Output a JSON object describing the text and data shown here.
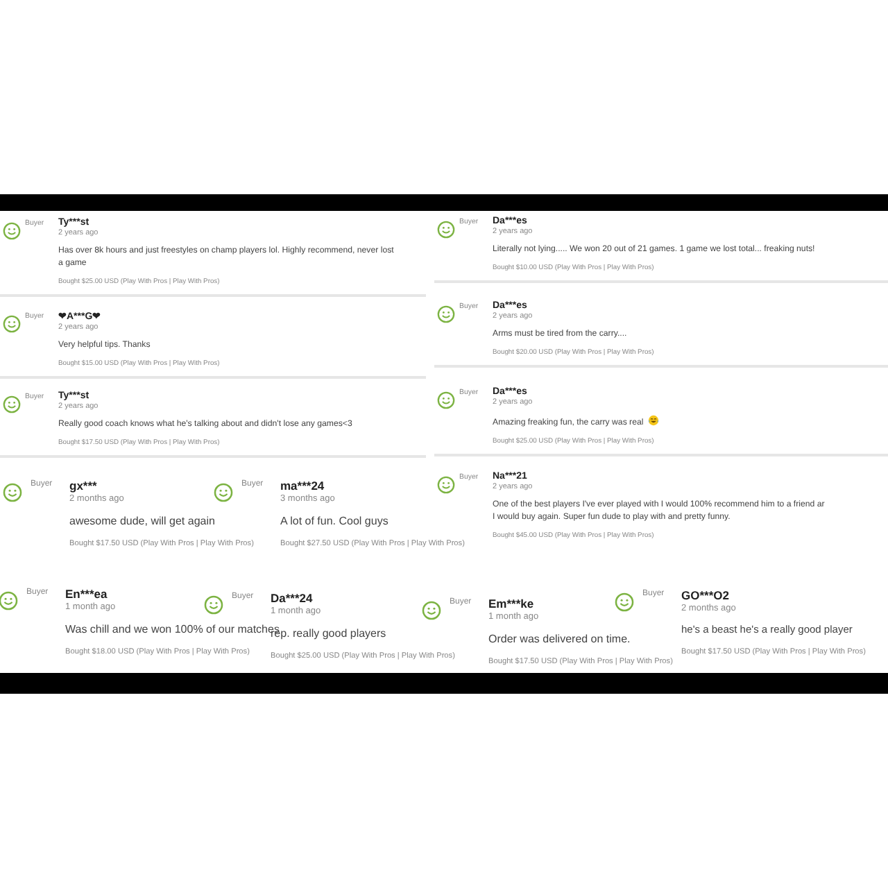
{
  "reviews": [
    {
      "name": "Ty***st",
      "badge": "Buyer",
      "date": "2 years ago",
      "text_lines": [
        "Has over 8k hours and just freestyles on champ players lol. Highly recommend, never lost",
        "a game"
      ],
      "bought": "Bought $25.00 USD  (Play With Pros | Play With Pros)"
    },
    {
      "name": "❤A***G❤",
      "badge": "Buyer",
      "date": "2 years ago",
      "text_lines": [
        "Very helpful tips. Thanks"
      ],
      "bought": "Bought $15.00 USD  (Play With Pros | Play With Pros)"
    },
    {
      "name": "Ty***st",
      "badge": "Buyer",
      "date": "2 years ago",
      "text_lines": [
        "Really good coach knows what he's talking about and didn't lose any games<3"
      ],
      "bought": "Bought $17.50 USD  (Play With Pros | Play With Pros)"
    },
    {
      "name": "Da***es",
      "badge": "Buyer",
      "date": "2 years ago",
      "text_lines": [
        "Literally not lying..... We won 20 out of 21 games. 1 game we lost total... freaking nuts!"
      ],
      "bought": "Bought $10.00 USD  (Play With Pros | Play With Pros)"
    },
    {
      "name": "Da***es",
      "badge": "Buyer",
      "date": "2 years ago",
      "text_lines": [
        "Arms must be tired from the carry...."
      ],
      "bought": "Bought $20.00 USD  (Play With Pros | Play With Pros)"
    },
    {
      "name": "Da***es",
      "badge": "Buyer",
      "date": "2 years ago",
      "text_lines": [
        "Amazing freaking fun, the carry was real"
      ],
      "emoji": true,
      "bought": "Bought $25.00 USD  (Play With Pros | Play With Pros)"
    },
    {
      "name": "Na***21",
      "badge": "Buyer",
      "date": "2 years ago",
      "text_lines": [
        "One of the best players I've ever played with I would 100% recommend him to a friend ar",
        "I would buy again. Super fun dude to play with and pretty funny."
      ],
      "bought": "Bought $45.00 USD  (Play With Pros | Play With Pros)"
    },
    {
      "name": "gx***",
      "badge": "Buyer",
      "date": "2 months ago",
      "text_lines": [
        "awesome dude, will get again"
      ],
      "bought": "Bought $17.50 USD  (Play With Pros | Play With Pros)"
    },
    {
      "name": "ma***24",
      "badge": "Buyer",
      "date": "3 months ago",
      "text_lines": [
        "A lot of fun. Cool guys"
      ],
      "bought": "Bought $27.50 USD  (Play With Pros | Play With Pros)"
    },
    {
      "name": "En***ea",
      "badge": "Buyer",
      "date": "1 month ago",
      "text_lines": [
        "Was chill and we won 100% of our matches"
      ],
      "bought": "Bought $18.00 USD  (Play With Pros | Play With Pros)"
    },
    {
      "name": "Da***24",
      "badge": "Buyer",
      "date": "1 month ago",
      "text_lines": [
        "rep. really good players"
      ],
      "bought": "Bought $25.00 USD  (Play With Pros | Play With Pros)"
    },
    {
      "name": "Em***ke",
      "badge": "Buyer",
      "date": "1 month ago",
      "text_lines": [
        "Order was delivered on time."
      ],
      "bought": "Bought $17.50 USD  (Play With Pros | Play With Pros)"
    },
    {
      "name": "GO***O2",
      "badge": "Buyer",
      "date": "2 months ago",
      "text_lines": [
        "he's a beast he's a really good player"
      ],
      "bought": "Bought $17.50 USD  (Play With Pros | Play With Pros)"
    }
  ]
}
